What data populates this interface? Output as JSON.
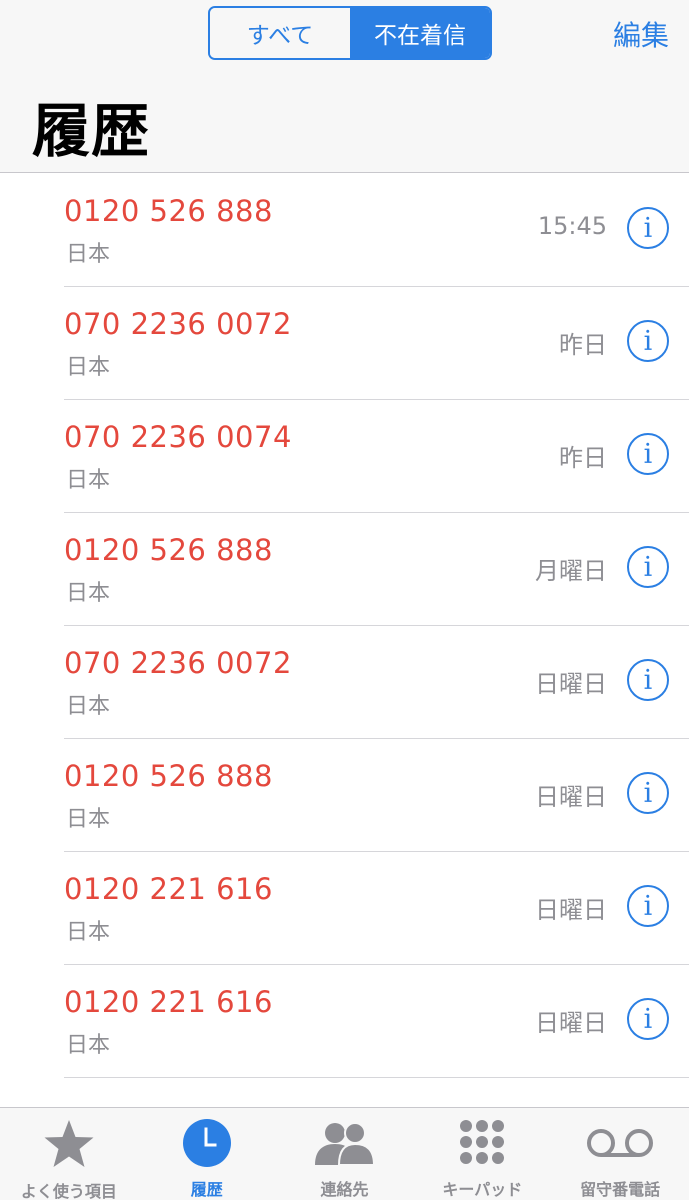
{
  "header": {
    "segments": [
      "すべて",
      "不在着信"
    ],
    "edit_label": "編集",
    "title": "履歴"
  },
  "calls": [
    {
      "number": "0120 526 888",
      "region": "日本",
      "time": "15:45"
    },
    {
      "number": "070 2236 0072",
      "region": "日本",
      "time": "昨日"
    },
    {
      "number": "070 2236 0074",
      "region": "日本",
      "time": "昨日"
    },
    {
      "number": "0120 526 888",
      "region": "日本",
      "time": "月曜日"
    },
    {
      "number": "070 2236 0072",
      "region": "日本",
      "time": "日曜日"
    },
    {
      "number": "0120 526 888",
      "region": "日本",
      "time": "日曜日"
    },
    {
      "number": "0120 221 616",
      "region": "日本",
      "time": "日曜日"
    },
    {
      "number": "0120 221 616",
      "region": "日本",
      "time": "日曜日"
    }
  ],
  "tabbar": {
    "favorites": "よく使う項目",
    "recents": "履歴",
    "contacts": "連絡先",
    "keypad": "キーパッド",
    "voicemail": "留守番電話"
  },
  "colors": {
    "accent": "#2b7fe3",
    "missed_call": "#e4483d",
    "secondary_text": "#8e8e93",
    "inactive_icon": "#8e8e93"
  },
  "icons": {
    "info": "info-circle-icon",
    "favorites": "star-icon",
    "recents": "clock-icon",
    "contacts": "people-icon",
    "keypad": "keypad-grid-icon",
    "voicemail": "voicemail-icon"
  }
}
